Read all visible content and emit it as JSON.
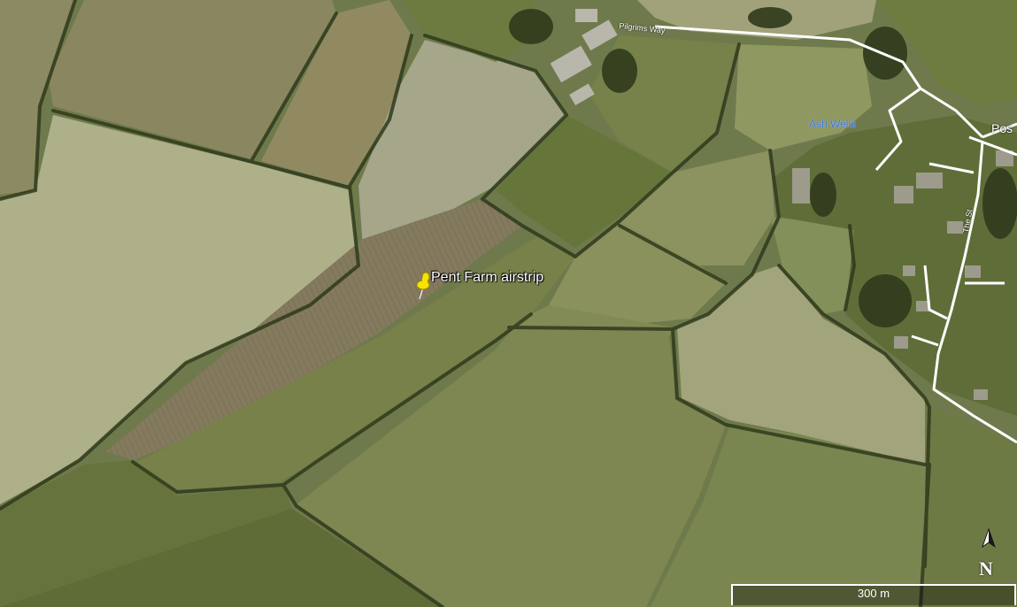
{
  "map": {
    "type": "satellite",
    "colors": {
      "field_dark": "#66703f",
      "field_mid": "#7b8550",
      "field_light": "#9aa077",
      "field_pale": "#aeb08a",
      "hedgerow": "#2f3a1c",
      "road": "#ffffff",
      "pin": "#f5e400"
    }
  },
  "marker": {
    "label": "Pent Farm airstrip",
    "icon": "pushpin-icon"
  },
  "places": {
    "ash_wells": "Ash Wells",
    "posting_partial": "Pos"
  },
  "roads": {
    "pilgrims_way": "Pilgrims Way",
    "the_st": "The St"
  },
  "compass": {
    "letter": "N",
    "icon": "north-arrow-icon"
  },
  "scale": {
    "label": "300 m"
  }
}
